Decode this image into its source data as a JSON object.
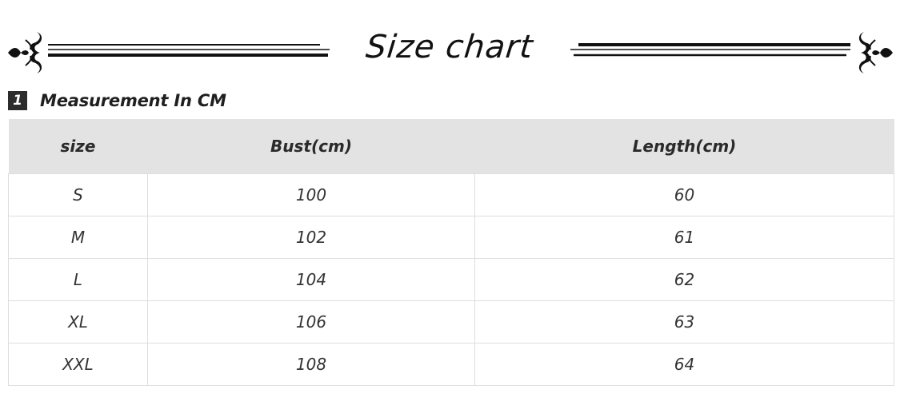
{
  "banner": {
    "title": "Size chart"
  },
  "section": {
    "number": "1",
    "title": "Measurement In CM"
  },
  "table": {
    "headers": [
      "size",
      "Bust(cm)",
      "Length(cm)"
    ],
    "rows": [
      [
        "S",
        "100",
        "60"
      ],
      [
        "M",
        "102",
        "61"
      ],
      [
        "L",
        "104",
        "62"
      ],
      [
        "XL",
        "106",
        "63"
      ],
      [
        "XXL",
        "108",
        "64"
      ]
    ]
  },
  "colors": {
    "header_bg": "#e3e3e3",
    "ink": "#111111",
    "grid_line": "#dedede"
  },
  "icons": [
    "left-flourish-icon",
    "right-flourish-icon"
  ]
}
